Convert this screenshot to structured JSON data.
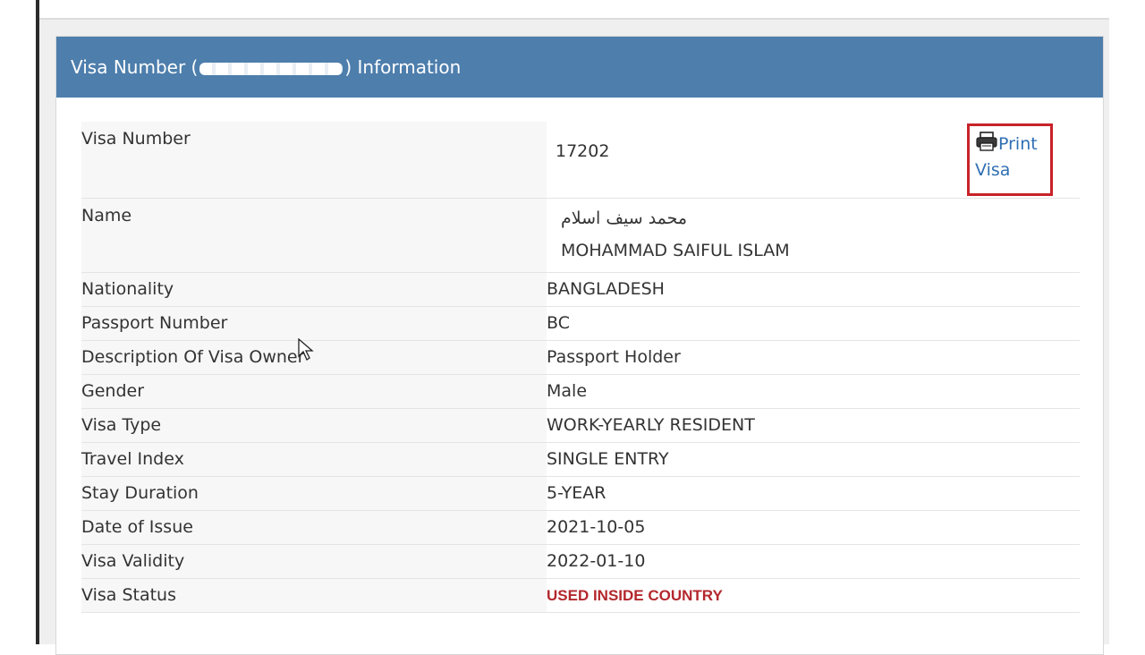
{
  "panel": {
    "title_prefix": "Visa Number (",
    "title_suffix": ") Information"
  },
  "print": {
    "label_line1": "Print",
    "label_line2": "Visa",
    "icon": "printer-icon"
  },
  "rows": [
    {
      "label": "Visa Number",
      "value": "17202"
    },
    {
      "label": "Name",
      "value_arabic": "محمد   سيف   اسلام",
      "value": "MOHAMMAD  SAIFUL ISLAM"
    },
    {
      "label": "Nationality",
      "value": "BANGLADESH"
    },
    {
      "label": "Passport Number",
      "value": "BC"
    },
    {
      "label": "Description Of Visa Owner",
      "value": "Passport Holder"
    },
    {
      "label": "Gender",
      "value": "Male"
    },
    {
      "label": "Visa Type",
      "value": "WORK-YEARLY RESIDENT"
    },
    {
      "label": "Travel Index",
      "value": "SINGLE ENTRY"
    },
    {
      "label": "Stay Duration",
      "value": "5-YEAR"
    },
    {
      "label": "Date of Issue",
      "value": "2021-10-05"
    },
    {
      "label": "Visa Validity",
      "value": "2022-01-10"
    },
    {
      "label": "Visa Status",
      "value": "USED INSIDE COUNTRY"
    }
  ],
  "colors": {
    "header_bg": "#4d7eac",
    "status_text": "#b3282d",
    "print_border": "#c82229",
    "link": "#2f6fb3"
  }
}
